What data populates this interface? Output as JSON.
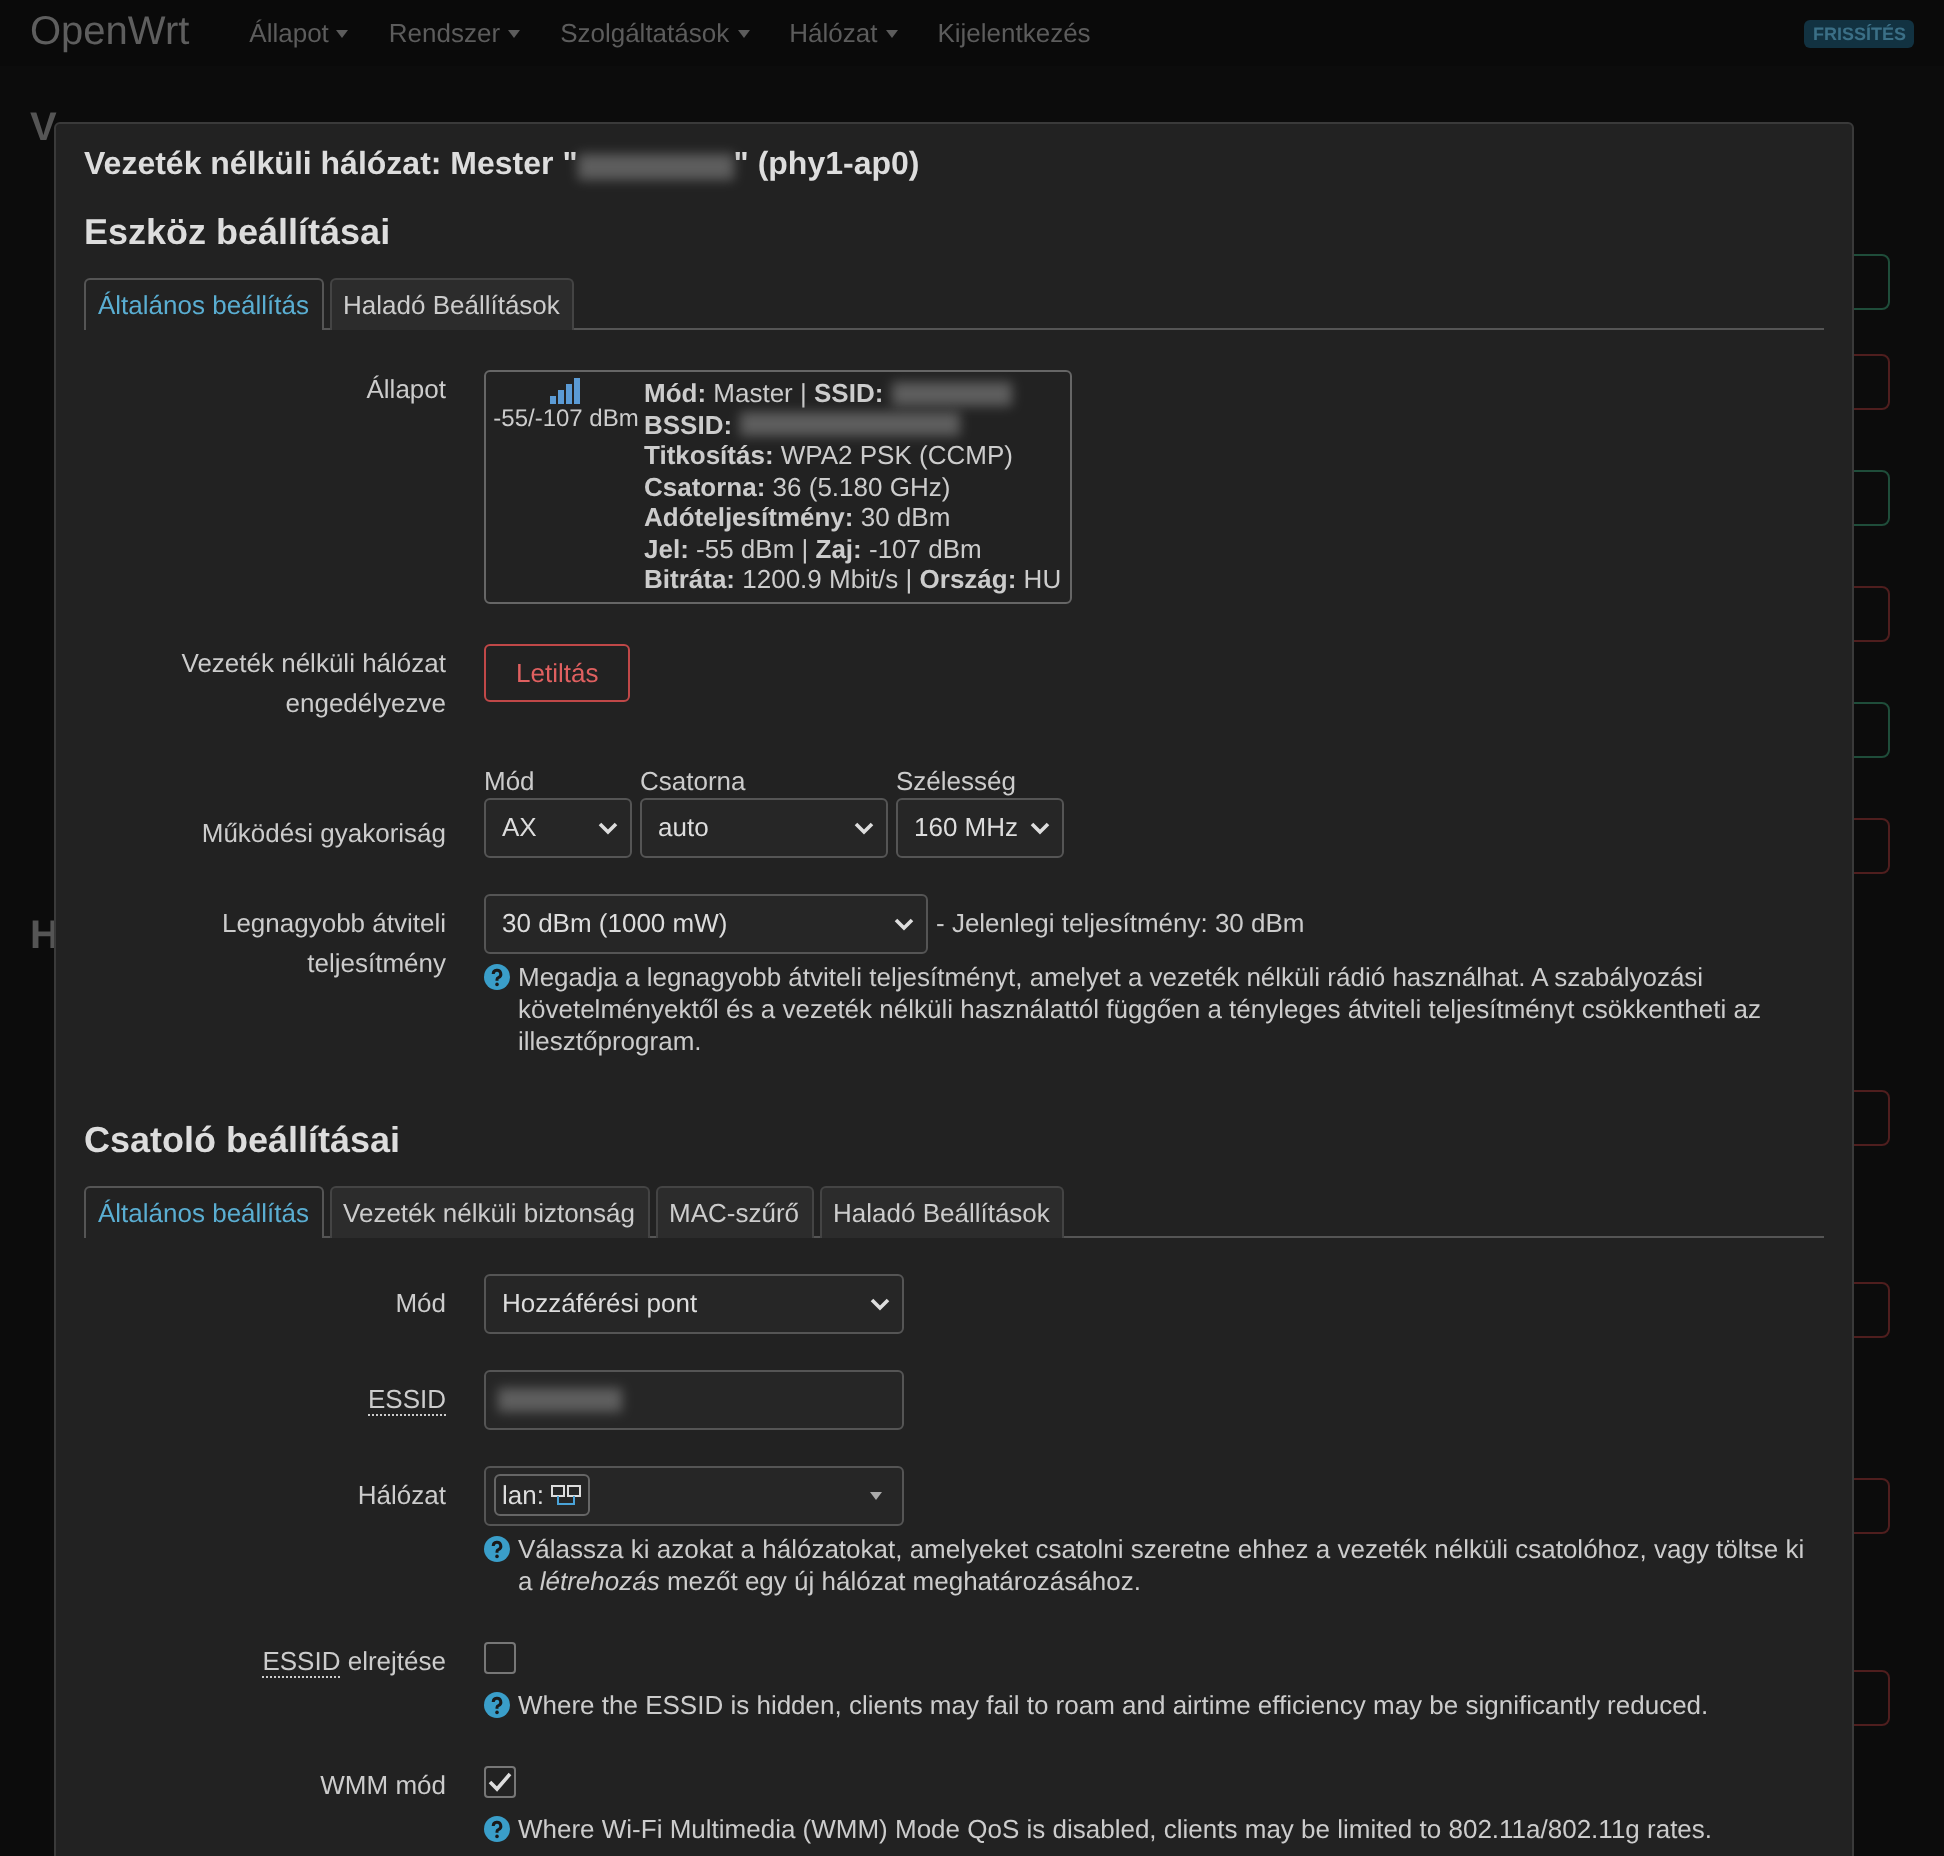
{
  "navbar": {
    "brand": "OpenWrt",
    "menus": [
      {
        "label": "Állapot",
        "dropdown": true
      },
      {
        "label": "Rendszer",
        "dropdown": true
      },
      {
        "label": "Szolgáltatások",
        "dropdown": true
      },
      {
        "label": "Hálózat",
        "dropdown": true
      },
      {
        "label": "Kijelentkezés",
        "dropdown": false
      }
    ],
    "badge": "FRISSÍTÉS"
  },
  "background": {
    "heading": "V",
    "heading_2": "H",
    "row_buttons": [
      {
        "kind": "enable"
      },
      {
        "kind": "disable"
      },
      {
        "kind": "enable"
      },
      {
        "kind": "disable"
      },
      {
        "kind": "enable"
      },
      {
        "kind": "disable"
      },
      {
        "kind": "disable"
      },
      {
        "kind": "disable"
      },
      {
        "kind": "disable"
      },
      {
        "kind": "disable"
      }
    ]
  },
  "modal": {
    "title_prefix": "Vezeték nélküli hálózat: Mester \"",
    "title_suffix": "\" (phy1-ap0)",
    "device": {
      "heading": "Eszköz beállításai",
      "tabs": [
        {
          "label": "Általános beállítás",
          "selected": true
        },
        {
          "label": "Haladó Beállítások",
          "selected": false
        }
      ],
      "status": {
        "label": "Állapot",
        "signal": "-55/-107 dBm",
        "lines": [
          {
            "text": "**Mód:** Master | **SSID:**",
            "redacted": true
          },
          {
            "text": "**BSSID:**",
            "redacted": true
          },
          {
            "text": "**Titkosítás:** WPA2 PSK (CCMP)",
            "redacted": false
          },
          {
            "text": "**Csatorna:** 36 (5.180 GHz)",
            "redacted": false
          },
          {
            "text": "**Adóteljesítmény:** 30 dBm",
            "redacted": false
          },
          {
            "text": "**Jel:** -55 dBm | **Zaj:** -107 dBm",
            "redacted": false
          },
          {
            "text": "**Bitráta:** 1200.9 Mbit/s | **Ország:** HU",
            "redacted": false
          }
        ]
      },
      "fields": [
        {
          "kind": "button",
          "label": "Vezeték nélküli hálózat engedélyezve",
          "button": "Letiltás"
        },
        {
          "kind": "selects",
          "label": "Működési gyakoriság",
          "selects": [
            {
              "caption": "Mód",
              "value": "AX"
            },
            {
              "caption": "Csatorna",
              "value": "auto"
            },
            {
              "caption": "Szélesség",
              "value": "160 MHz"
            }
          ]
        },
        {
          "kind": "select",
          "label": "Legnagyobb átviteli teljesítmény",
          "value": "30 dBm (1000 mW)",
          "note": "- Jelenlegi teljesítmény: 30 dBm",
          "help": "Megadja a legnagyobb átviteli teljesítményt, amelyet a vezeték nélküli rádió használhat. A szabályozási követelményektől és a vezeték nélküli használattól függően a tényleges átviteli teljesítményt csökkentheti az illesztőprogram."
        }
      ]
    },
    "interface": {
      "heading": "Csatoló beállításai",
      "tabs": [
        {
          "label": "Általános beállítás",
          "selected": true
        },
        {
          "label": "Vezeték nélküli biztonság",
          "selected": false
        },
        {
          "label": "MAC-szűrő",
          "selected": false
        },
        {
          "label": "Haladó Beállítások",
          "selected": false
        }
      ],
      "fields": [
        {
          "kind": "select",
          "label": "Mód",
          "value": "Hozzáférési pont"
        },
        {
          "kind": "text",
          "abbr": "ESSID",
          "redacted": true
        },
        {
          "kind": "network",
          "label": "Hálózat",
          "tag": "lan:",
          "help": "Válassza ki azokat a hálózatokat, amelyeket csatolni szeretne ehhez a vezeték nélküli csatolóhoz, vagy töltse ki a *létrehozás* mezőt egy új hálózat meghatározásához."
        },
        {
          "kind": "checkbox",
          "abbr": "ESSID",
          "label": "elrejtése",
          "checked": false,
          "help": "Where the ESSID is hidden, clients may fail to roam and airtime efficiency may be significantly reduced."
        },
        {
          "kind": "checkbox",
          "label": "WMM mód",
          "checked": true,
          "help": "Where Wi-Fi Multimedia (WMM) Mode QoS is disabled, clients may be limited to 802.11a/802.11g rates."
        }
      ]
    }
  }
}
